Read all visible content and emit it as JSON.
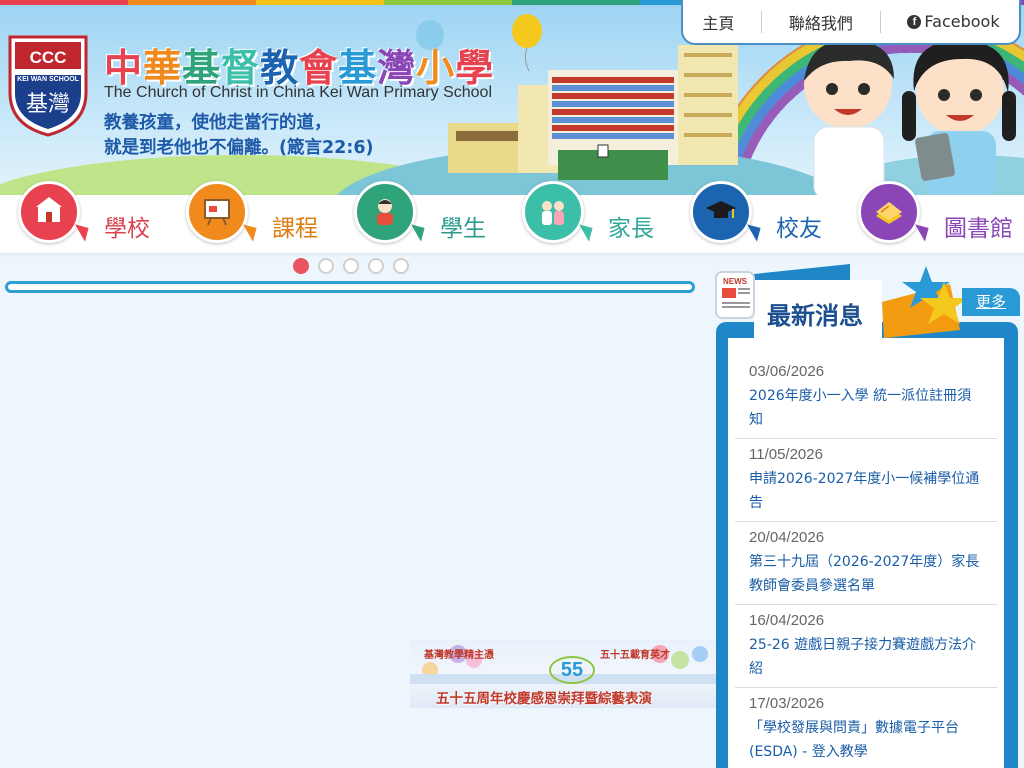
{
  "header": {
    "school_name_zh": [
      "中",
      "華",
      "基",
      "督",
      "教",
      "會",
      "基",
      "灣",
      "小",
      "學"
    ],
    "school_name_en": "The Church of Christ in China Kei Wan Primary School",
    "motto_line1": "教養孩童，使他走當行的道，",
    "motto_line2": "就是到老他也不偏離。(箴言22:6)",
    "logo_text_top": "CCC",
    "logo_text_mid": "KEI WAN SCHOOL",
    "logo_text_bottom": "基灣"
  },
  "top_links": {
    "home": "主頁",
    "contact": "聯絡我們",
    "facebook": "Facebook"
  },
  "nav": [
    {
      "label": "學校",
      "color": "#e8414f",
      "text_color": "#d8434f",
      "icon": "school-icon"
    },
    {
      "label": "課程",
      "color": "#f08a1c",
      "text_color": "#e07d12",
      "icon": "presentation-icon"
    },
    {
      "label": "學生",
      "color": "#2fa37a",
      "text_color": "#2a9a8e",
      "icon": "student-icon"
    },
    {
      "label": "家長",
      "color": "#3bbfa8",
      "text_color": "#2fa79a",
      "icon": "parents-icon"
    },
    {
      "label": "校友",
      "color": "#1c63b0",
      "text_color": "#1c63b0",
      "icon": "graduation-cap-icon"
    },
    {
      "label": "圖書館",
      "color": "#8a45b7",
      "text_color": "#8a45b7",
      "icon": "book-icon"
    }
  ],
  "slider": {
    "dot_count": 5,
    "active_index": 0
  },
  "banner": {
    "top_left": "基灣教學精主憑",
    "top_right": "五十五載育英才",
    "main": "五十五周年校慶感恩崇拜暨綜藝表演",
    "anniversary": "55"
  },
  "news": {
    "badge": "NEWS",
    "title": "最新消息",
    "more": "更多",
    "items": [
      {
        "date": "03/06/2026",
        "title": "2026年度小一入學 統一派位註冊須知"
      },
      {
        "date": "11/05/2026",
        "title": "申請2026-2027年度小一候補學位通告"
      },
      {
        "date": "20/04/2026",
        "title": "第三十九屆（2026-2027年度）家長教師會委員參選名單"
      },
      {
        "date": "16/04/2026",
        "title": "25-26 遊戲日親子接力賽遊戲方法介紹"
      },
      {
        "date": "17/03/2026",
        "title": "「學校發展與問責」數據電子平台(ESDA) - 登入教學"
      }
    ]
  },
  "colors": {
    "accent_blue": "#1f87c7",
    "dot_active": "#e9545e",
    "title_colors": [
      "#e8414f",
      "#f08a1c",
      "#2fa37a",
      "#3bbfa8",
      "#1c63b0",
      "#e8414f",
      "#2a9ad6",
      "#8a45b7",
      "#f08a1c",
      "#e8414f"
    ]
  }
}
